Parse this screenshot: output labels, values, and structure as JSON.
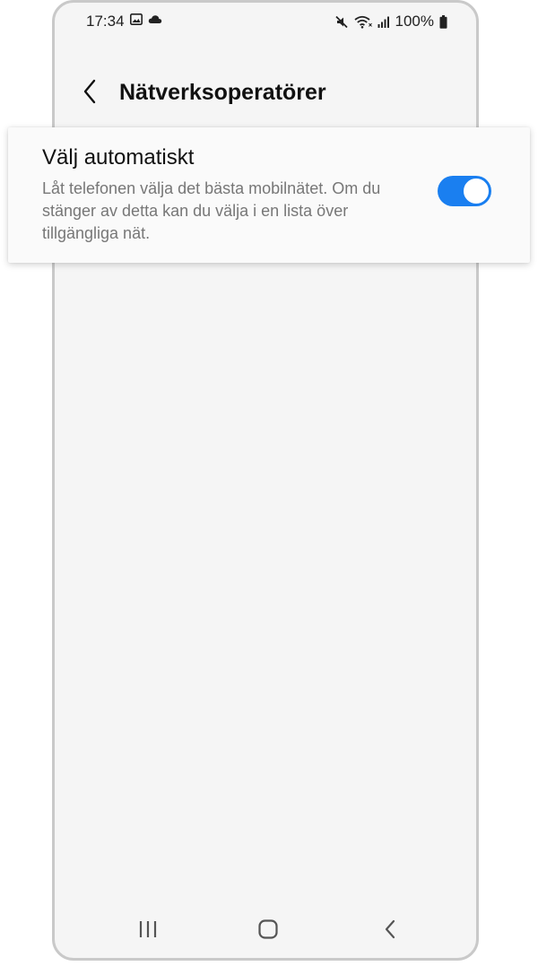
{
  "status_bar": {
    "time": "17:34",
    "battery_percent": "100%",
    "left_icons": [
      "image-icon",
      "cloud-icon"
    ],
    "right_icons": [
      "mute-icon",
      "wifi-icon",
      "signal-icon",
      "battery-icon"
    ]
  },
  "header": {
    "title": "Nätverksoperatörer"
  },
  "setting": {
    "title": "Välj automatiskt",
    "description": "Låt telefonen välja det bästa mobilnätet. Om du stänger av detta kan du välja i en lista över tillgängliga nät.",
    "toggle_on": true
  },
  "colors": {
    "accent": "#1a7ff0",
    "background": "#f5f5f5"
  },
  "navbar": {
    "icons": [
      "recent-apps-icon",
      "home-icon",
      "back-icon"
    ]
  }
}
